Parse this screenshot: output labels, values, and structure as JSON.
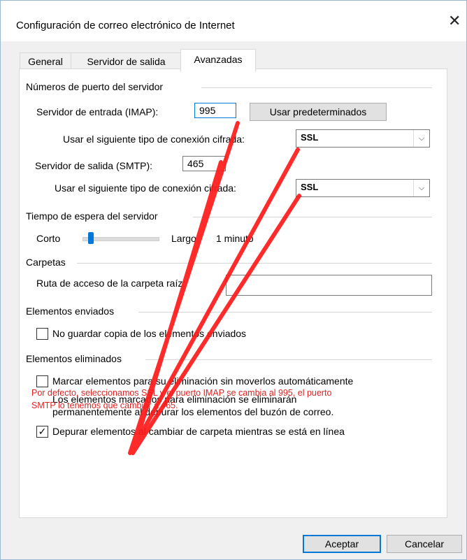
{
  "window": {
    "title": "Configuración de correo electrónico de Internet",
    "close_glyph": "✕"
  },
  "tabs": [
    {
      "label": "General",
      "active": false
    },
    {
      "label": "Servidor de salida",
      "active": false
    },
    {
      "label": "Avanzadas",
      "active": true
    }
  ],
  "ports": {
    "group_label": "Números de puerto del servidor",
    "incoming_label": "Servidor de entrada (IMAP):",
    "incoming_value": "995",
    "use_defaults_label": "Usar predeterminados",
    "incoming_encryption_label": "Usar el siguiente tipo de conexión cifrada:",
    "incoming_encryption_value": "SSL",
    "outgoing_label": "Servidor de salida (SMTP):",
    "outgoing_value": "465",
    "outgoing_encryption_label": "Usar el siguiente tipo de conexión cifrada:",
    "outgoing_encryption_value": "SSL"
  },
  "timeout": {
    "group_label": "Tiempo de espera del servidor",
    "short_label": "Corto",
    "long_label": "Largo",
    "value_label": "1 minuto",
    "level": 0.1
  },
  "folders": {
    "group_label": "Carpetas",
    "root_path_label": "Ruta de acceso de la carpeta raíz:",
    "root_path_value": ""
  },
  "sent_items": {
    "group_label": "Elementos enviados",
    "dont_save_label": "No guardar copia de los elementos enviados",
    "dont_save_checked": false
  },
  "deleted_items": {
    "group_label": "Elementos eliminados",
    "mark_label": "Marcar elementos para su eliminación sin moverlos automáticamente",
    "mark_checked": false,
    "info_line1": "Los elementos marcados para eliminación se eliminarán",
    "info_line2": "permanentemente al depurar los elementos del buzón de correo.",
    "purge_label": "Depurar elementos al cambiar de carpeta mientras se está en línea",
    "purge_checked": true
  },
  "annotation": {
    "line1": "Por defecto, seleccionamos SSL y el puerto IMAP se cambia al 995, el puerto",
    "line2": "SMTP lo tenemos que cambiar a 465.",
    "color": "#e32222"
  },
  "footer": {
    "ok_label": "Aceptar",
    "cancel_label": "Cancelar"
  },
  "icons": {
    "dropdown": "chevron-down-icon",
    "checkmark": "checkmark-icon",
    "close": "close-icon"
  }
}
